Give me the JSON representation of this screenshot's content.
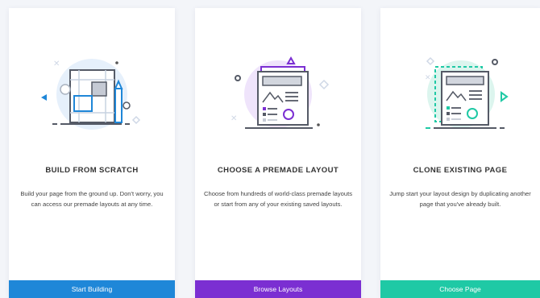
{
  "cards": [
    {
      "title": "BUILD FROM SCRATCH",
      "description": "Build your page from the ground up. Don't worry, you can access our premade layouts at any time.",
      "button_label": "Start Building",
      "accent": "#1f87d8"
    },
    {
      "title": "CHOOSE A PREMADE LAYOUT",
      "description": "Choose from hundreds of world-class premade layouts or start from any of your existing saved layouts.",
      "button_label": "Browse Layouts",
      "accent": "#7b2fd2"
    },
    {
      "title": "CLONE EXISTING PAGE",
      "description": "Jump start your layout design by duplicating another page that you've already built.",
      "button_label": "Choose Page",
      "accent": "#1fc9a5"
    }
  ]
}
